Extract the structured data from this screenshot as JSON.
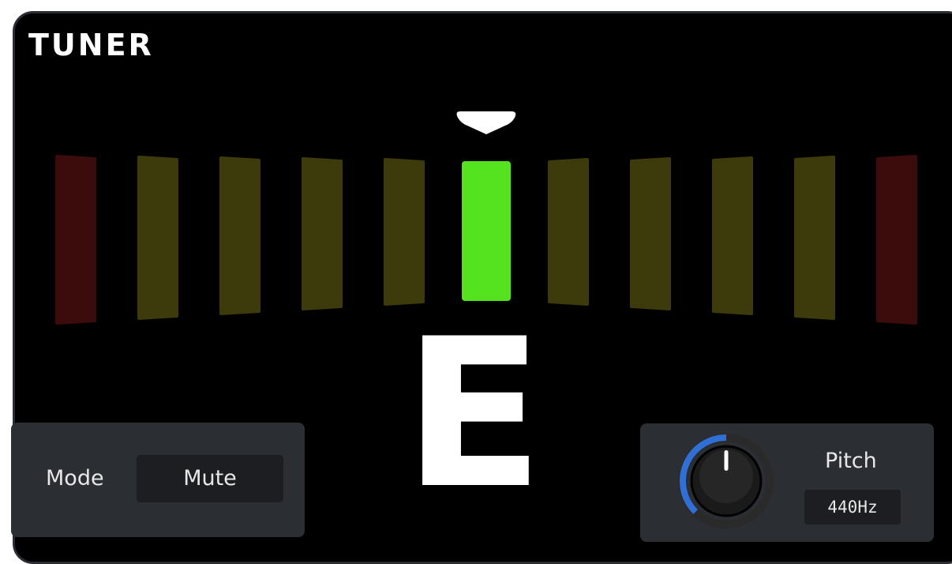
{
  "title": "TUNER",
  "note": "E",
  "tuner": {
    "segment_count": 11,
    "active_segment_index": 5,
    "colors": {
      "active": "#56e31f",
      "inactive_near": "#3d3a0b",
      "inactive_edge": "#3c0b0b",
      "indicator": "#ffffff"
    }
  },
  "mode": {
    "label": "Mode",
    "value": "Mute"
  },
  "pitch": {
    "label": "Pitch",
    "value": "440Hz",
    "knob_colors": {
      "arc": "#2f6fd6",
      "track": "#2a2a2a",
      "pointer": "#ffffff"
    }
  }
}
